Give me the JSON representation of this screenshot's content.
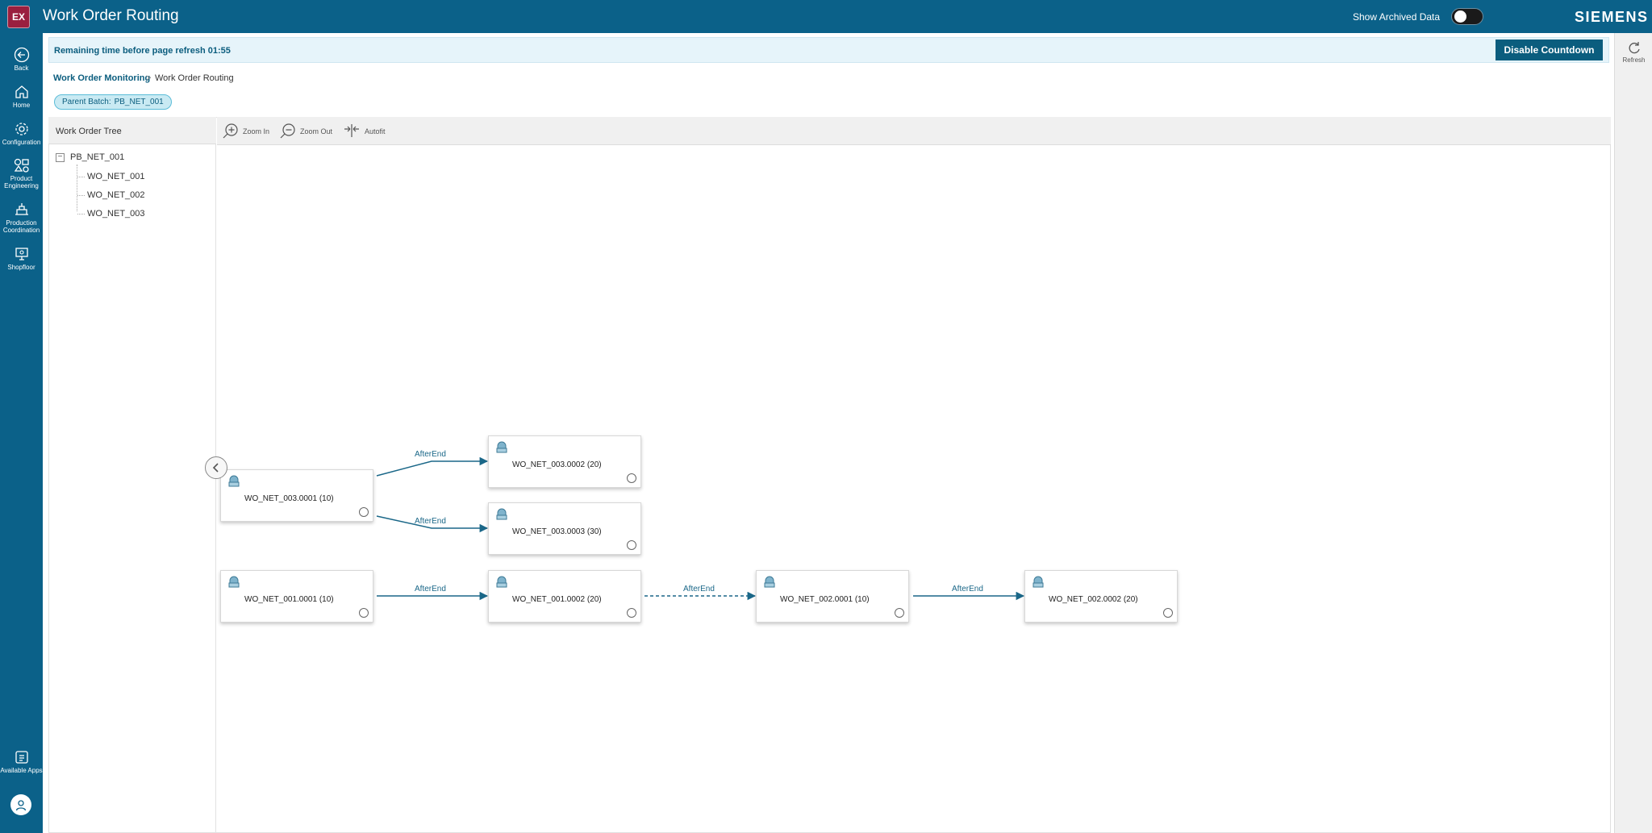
{
  "header": {
    "app_badge": "EX",
    "title": "Work Order Routing",
    "archived_label": "Show Archived Data",
    "archived_toggle_on": false,
    "brand": "SIEMENS"
  },
  "rail": {
    "items": [
      {
        "label": "Back",
        "icon": "back-arrow-icon"
      },
      {
        "label": "Home",
        "icon": "home-icon"
      },
      {
        "label": "Configuration",
        "icon": "gear-icon"
      },
      {
        "label": "Product Engineering",
        "icon": "product-engineering-icon"
      },
      {
        "label": "Production Coordination",
        "icon": "production-coordination-icon"
      },
      {
        "label": "Shopfloor",
        "icon": "shopfloor-icon"
      }
    ],
    "bottom": {
      "label": "Available Apps",
      "icon": "available-apps-icon"
    },
    "avatar_icon": "user-avatar-icon"
  },
  "right_rail": {
    "refresh_label": "Refresh",
    "icon": "refresh-icon"
  },
  "banner": {
    "text": "Remaining time before page refresh 01:55",
    "button_label": "Disable Countdown"
  },
  "breadcrumb": {
    "parent": "Work Order Monitoring",
    "separator": ">",
    "current": "Work Order Routing"
  },
  "parent_batch": {
    "label": "Parent Batch:",
    "value": "PB_NET_001"
  },
  "tree": {
    "header": "Work Order Tree",
    "root": {
      "toggle": "−",
      "label": "PB_NET_001"
    },
    "children": [
      "WO_NET_001",
      "WO_NET_002",
      "WO_NET_003"
    ]
  },
  "toolbar": {
    "zoom_in": "Zoom In",
    "zoom_out": "Zoom Out",
    "autofit": "Autofit"
  },
  "graph": {
    "nodes": [
      {
        "id": "n1",
        "label": "WO_NET_003.0001 (10)"
      },
      {
        "id": "n2",
        "label": "WO_NET_003.0002 (20)"
      },
      {
        "id": "n3",
        "label": "WO_NET_003.0003 (30)"
      },
      {
        "id": "n4",
        "label": "WO_NET_001.0001 (10)"
      },
      {
        "id": "n5",
        "label": "WO_NET_001.0002 (20)"
      },
      {
        "id": "n6",
        "label": "WO_NET_002.0001 (10)"
      },
      {
        "id": "n7",
        "label": "WO_NET_002.0002 (20)"
      }
    ],
    "edges": [
      {
        "from": "n1",
        "to": "n2",
        "label": "AfterEnd",
        "style": "solid"
      },
      {
        "from": "n1",
        "to": "n3",
        "label": "AfterEnd",
        "style": "solid"
      },
      {
        "from": "n4",
        "to": "n5",
        "label": "AfterEnd",
        "style": "solid"
      },
      {
        "from": "n5",
        "to": "n6",
        "label": "AfterEnd",
        "style": "dashed"
      },
      {
        "from": "n6",
        "to": "n7",
        "label": "AfterEnd",
        "style": "solid"
      }
    ]
  },
  "colors": {
    "brand_bar": "#0b6189",
    "accent": "#0b5d7e",
    "edge": "#1a6788",
    "banner_bg": "#e6f4fa"
  }
}
